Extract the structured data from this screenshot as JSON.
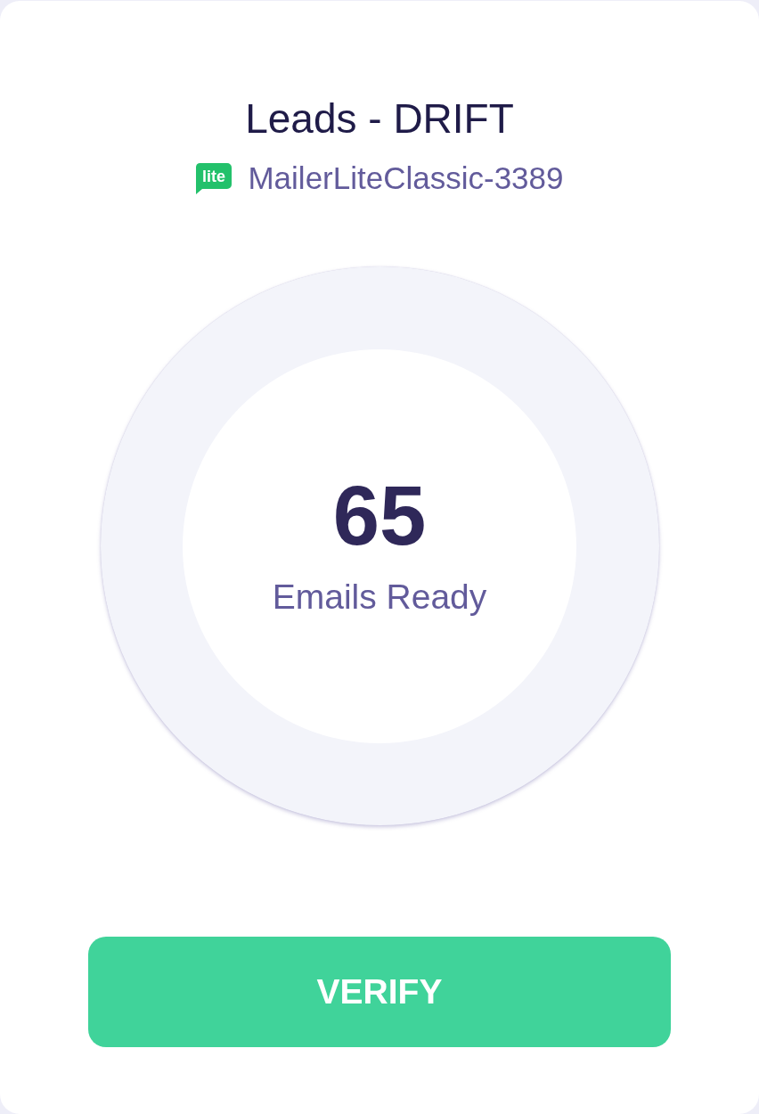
{
  "card": {
    "title": "Leads - DRIFT",
    "source": {
      "logo_text": "lite",
      "name": "MailerLiteClassic-3389"
    }
  },
  "summary": {
    "count": "65",
    "label": "Emails Ready"
  },
  "action": {
    "label": "VERIFY"
  }
}
